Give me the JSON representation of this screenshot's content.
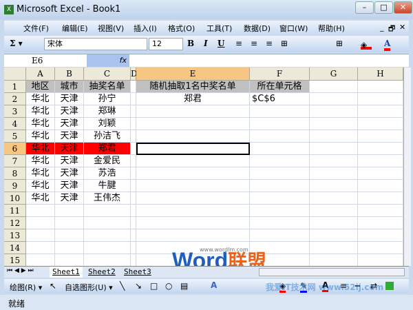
{
  "window": {
    "title": "Microsoft Excel - Book1",
    "minimize": "–",
    "maximize": "□",
    "close": "✕"
  },
  "menu": [
    "文件(F)",
    "编辑(E)",
    "视图(V)",
    "插入(I)",
    "格式(O)",
    "工具(T)",
    "数据(D)",
    "窗口(W)",
    "帮助(H)"
  ],
  "menu_controls": [
    "_",
    "🗗",
    "✕"
  ],
  "toolbar": {
    "autosum": "Σ ▾",
    "font": "宋体",
    "size": "12",
    "bold": "B",
    "italic": "I",
    "underline": "U",
    "fill_color": "#ff0000",
    "font_color": "#ff0000"
  },
  "formula_bar": {
    "name_box": "E6",
    "fx": "fx",
    "value": ""
  },
  "columns": [
    "A",
    "B",
    "C",
    "D",
    "E",
    "F",
    "G",
    "H"
  ],
  "rows": [
    "1",
    "2",
    "3",
    "4",
    "5",
    "6",
    "7",
    "8",
    "9",
    "10",
    "11",
    "12",
    "13",
    "14",
    "15"
  ],
  "cells": {
    "A": [
      "地区",
      "华北",
      "华北",
      "华北",
      "华北",
      "华北",
      "华北",
      "华北",
      "华北",
      "华北"
    ],
    "B": [
      "城市",
      "天津",
      "天津",
      "天津",
      "天津",
      "天津",
      "天津",
      "天津",
      "天津",
      "天津"
    ],
    "C": [
      "抽奖名单",
      "孙宁",
      "郑琳",
      "刘颖",
      "孙洁飞",
      "郑君",
      "金爱民",
      "苏浩",
      "牛腱",
      "王伟杰"
    ],
    "E1": "随机抽取1名中奖名单",
    "F1": "所在单元格",
    "E2": "郑君",
    "F2": "$C$6"
  },
  "selected_cell": "E6",
  "highlight_row": "6",
  "highlight_color": "#ff0000",
  "header_fill": "#c0c0c0",
  "sheet_tabs": [
    "Sheet1",
    "Sheet2",
    "Sheet3"
  ],
  "draw_toolbar": {
    "draw": "绘图(R) ▾",
    "autoshapes": "自选图形(U) ▾"
  },
  "status": "就绪",
  "watermark": {
    "logo": "Word",
    "logo_cn": "联盟",
    "url": "www.wordlm.com",
    "site2": "我爱IT技术网 www.52ij.com"
  }
}
